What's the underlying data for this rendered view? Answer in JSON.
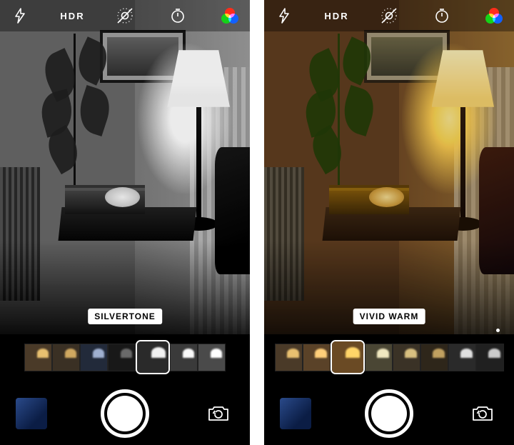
{
  "left": {
    "toolbar": {
      "hdr_label": "HDR"
    },
    "filter_label": "SILVERTONE",
    "filters_visible": [
      "warm-dark",
      "warm",
      "cool",
      "mono-dark",
      "silvertone",
      "mono-light",
      "mono-bright"
    ],
    "selected_filter_index": 4
  },
  "right": {
    "toolbar": {
      "hdr_label": "HDR"
    },
    "filter_label": "VIVID WARM",
    "filters_visible": [
      "original",
      "vivid",
      "vivid-warm",
      "vivid-cool",
      "dramatic",
      "dramatic-warm",
      "dramatic-cool",
      "mono"
    ],
    "selected_filter_index": 2
  },
  "icons": {
    "flash": "flash-icon",
    "hdr": "hdr-label",
    "live": "live-photo-icon",
    "timer": "timer-icon",
    "filters": "filters-icon",
    "shutter": "shutter-button",
    "switch": "switch-camera-icon",
    "recent": "recent-photo-thumb"
  }
}
